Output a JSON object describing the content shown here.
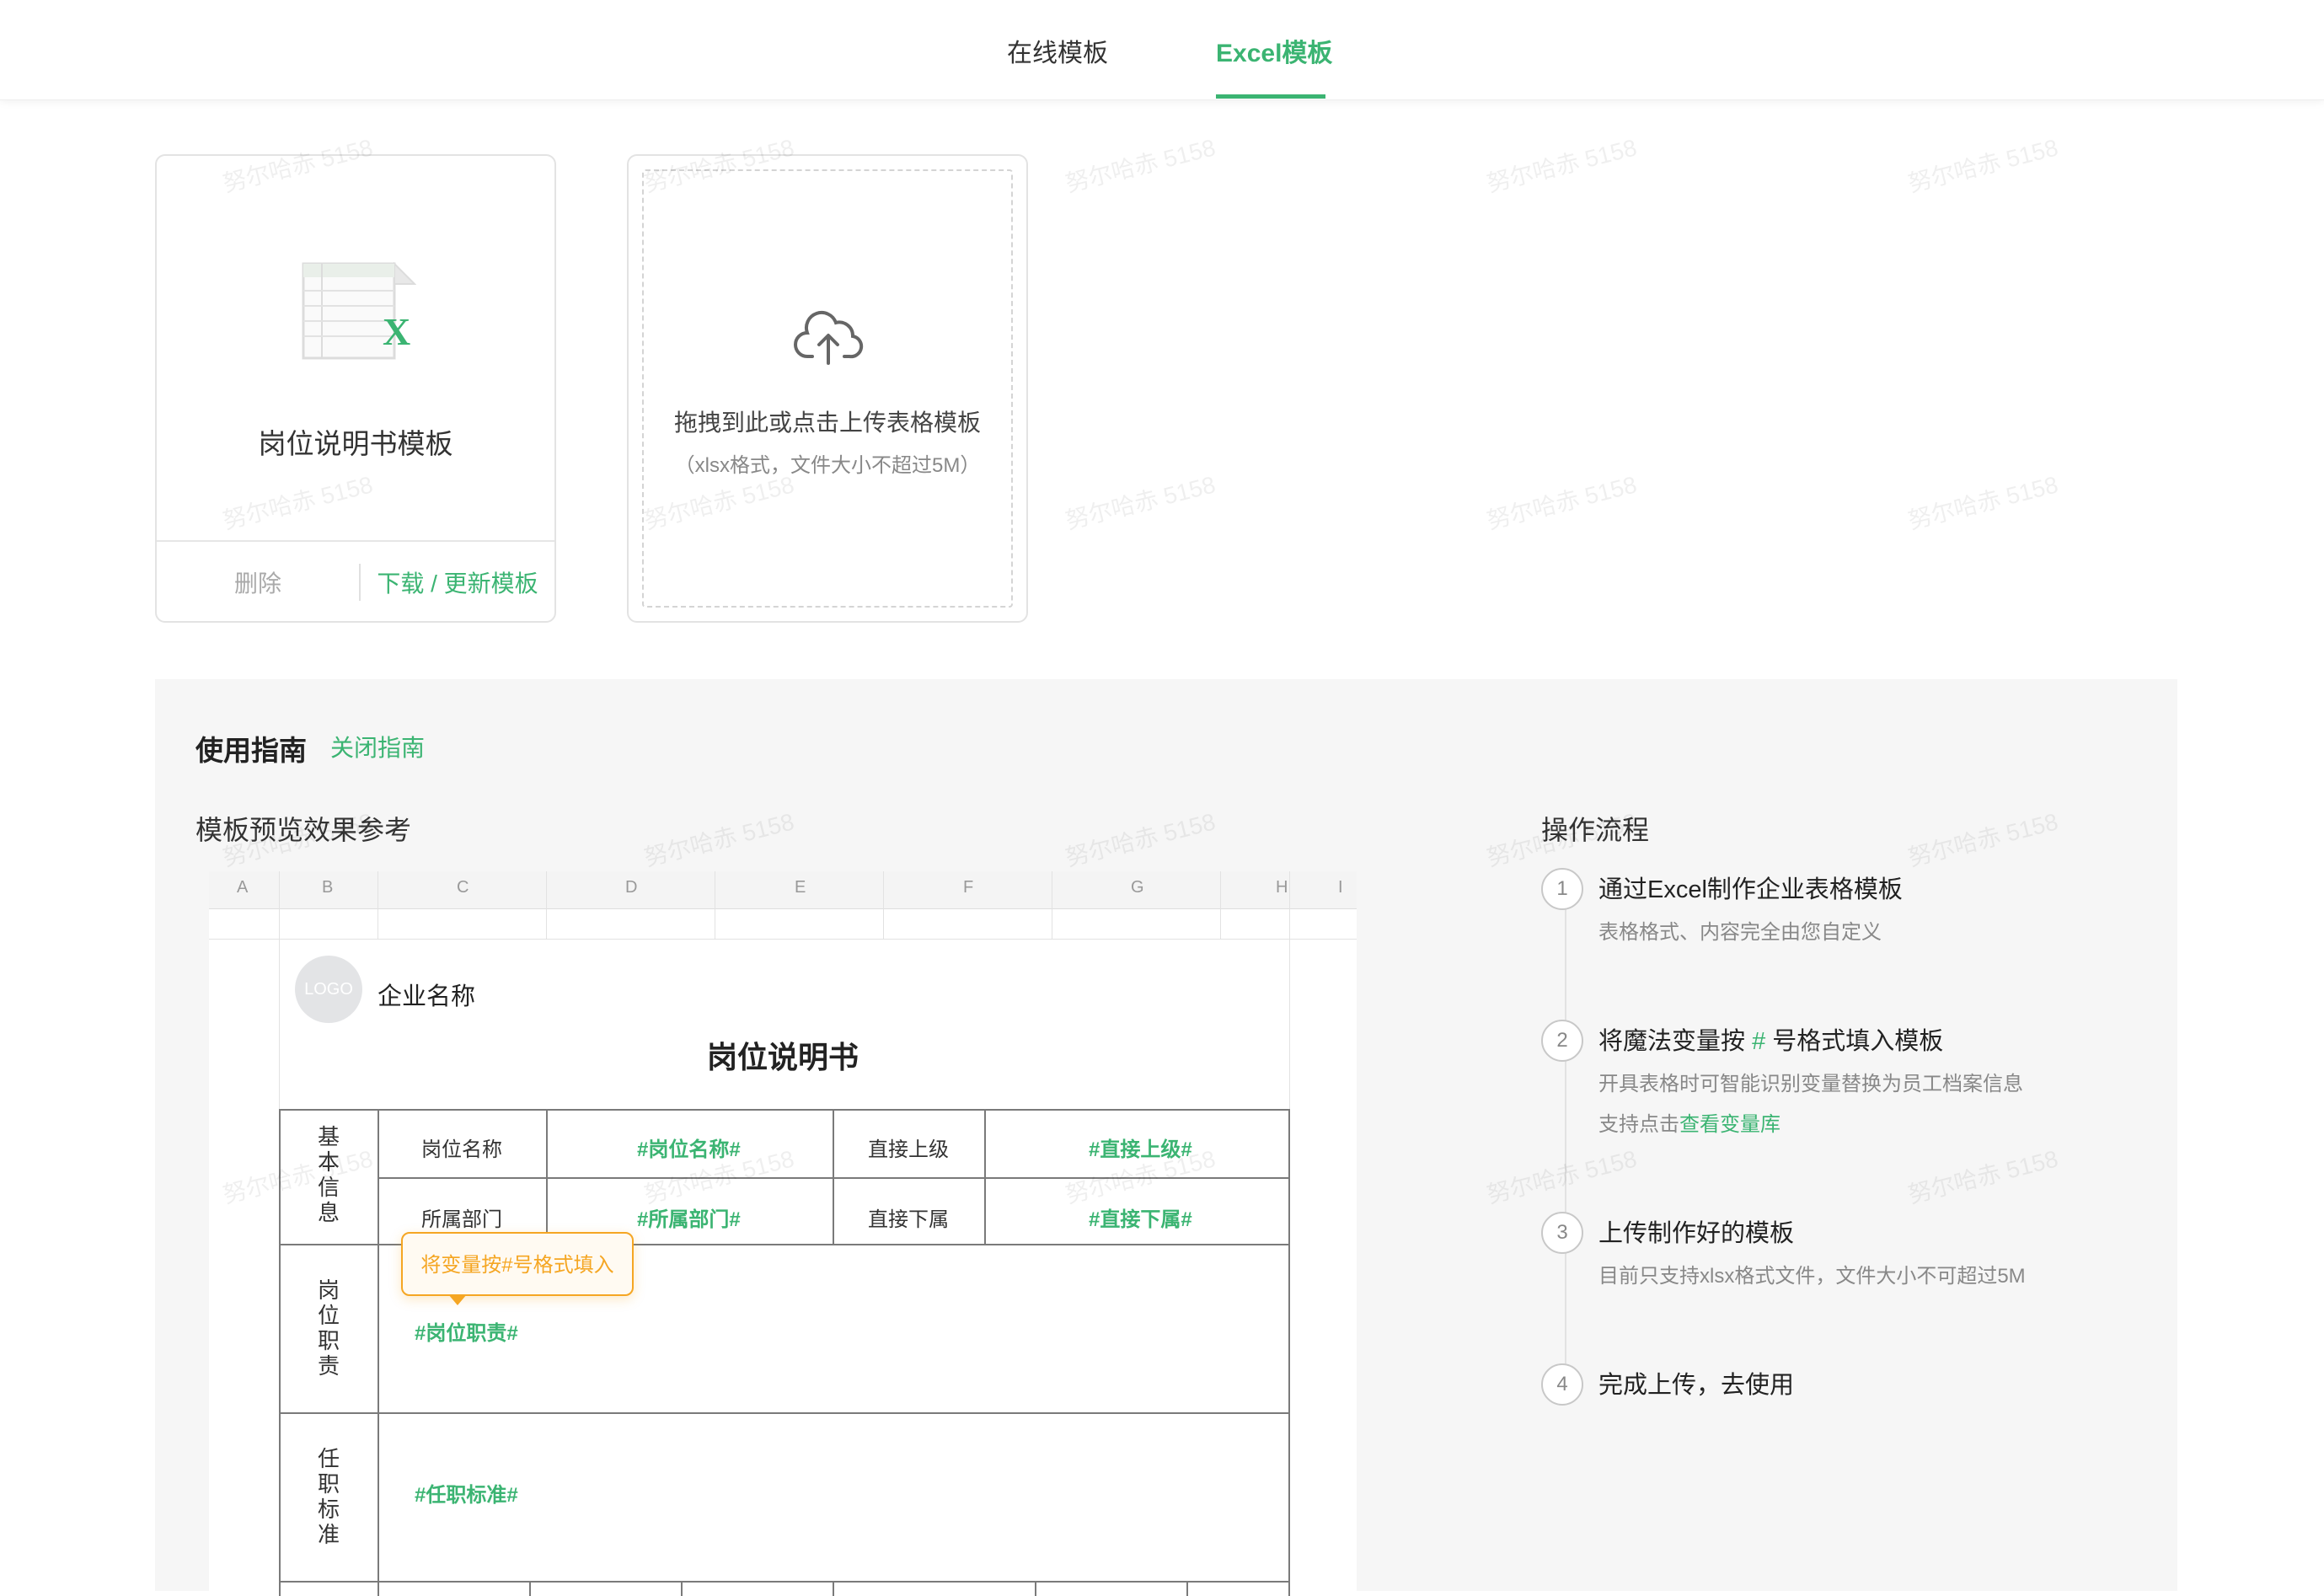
{
  "tabs": [
    {
      "label": "在线模板",
      "active": false
    },
    {
      "label": "Excel模板",
      "active": true
    }
  ],
  "template_card": {
    "title": "岗位说明书模板",
    "delete_label": "删除",
    "download_label": "下载 / 更新模板",
    "icon": "excel-file-icon"
  },
  "upload_card": {
    "icon": "cloud-upload-icon",
    "line1": "拖拽到此或点击上传表格模板",
    "line2": "（xlsx格式，文件大小不超过5M）"
  },
  "guide": {
    "title": "使用指南",
    "close_label": "关闭指南",
    "preview_title": "模板预览效果参考",
    "flow_title": "操作流程"
  },
  "preview": {
    "columns": [
      "A",
      "B",
      "C",
      "D",
      "E",
      "F",
      "G",
      "H",
      "I"
    ],
    "logo_text": "LOGO",
    "company": "企业名称",
    "doc_title": "岗位说明书",
    "section_basic": "基本信息",
    "section_duty": "岗位职责",
    "section_req": "任职标准",
    "label_position": "岗位名称",
    "var_position": "#岗位名称#",
    "label_superior": "直接上级",
    "var_superior": "#直接上级#",
    "label_dept": "所属部门",
    "var_dept": "#所属部门#",
    "label_sub": "直接下属",
    "var_sub": "#直接下属#",
    "var_duty": "#岗位职责#",
    "var_req": "#任职标准#",
    "tooltip": "将变量按#号格式填入"
  },
  "steps": [
    {
      "num": "1",
      "title": "通过Excel制作企业表格模板",
      "desc": "表格格式、内容完全由您自定义"
    },
    {
      "num": "2",
      "title_a": "将魔法变量按 ",
      "title_hash": "#",
      "title_b": " 号格式填入模板",
      "desc": "开具表格时可智能识别变量替换为员工档案信息",
      "desc2_a": "支持点击",
      "desc2_link": "查看变量库"
    },
    {
      "num": "3",
      "title": "上传制作好的模板",
      "desc": "目前只支持xlsx格式文件，文件大小不可超过5M"
    },
    {
      "num": "4",
      "title": "完成上传，去使用"
    }
  ],
  "watermark": "努尔哈赤 5158",
  "colors": {
    "accent": "#3bb472",
    "tooltip": "#f5a623",
    "guide_bg": "#f6f6f6"
  }
}
